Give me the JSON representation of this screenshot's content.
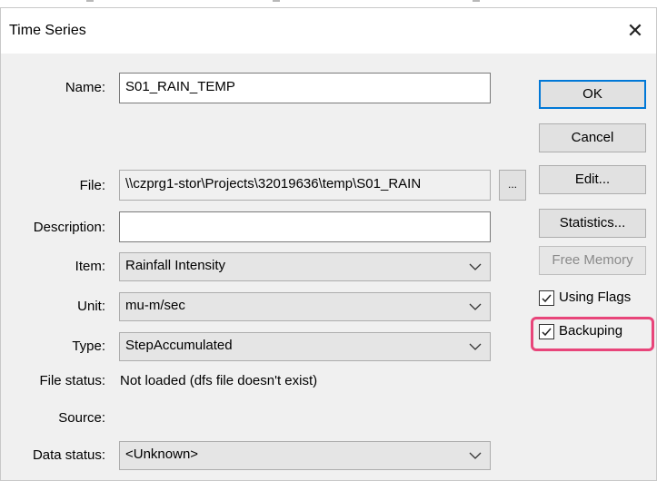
{
  "window": {
    "title": "Time Series",
    "close_glyph": "✕"
  },
  "fields": {
    "name": {
      "label": "Name:",
      "value": "S01_RAIN_TEMP"
    },
    "file": {
      "label": "File:",
      "value": "\\\\czprg1-stor\\Projects\\32019636\\temp\\S01_RAIN",
      "browse_label": "..."
    },
    "description": {
      "label": "Description:",
      "value": ""
    },
    "item": {
      "label": "Item:",
      "value": "Rainfall Intensity"
    },
    "unit": {
      "label": "Unit:",
      "value": "mu-m/sec"
    },
    "type": {
      "label": "Type:",
      "value": "StepAccumulated"
    },
    "file_status": {
      "label": "File status:",
      "value": "Not loaded (dfs file doesn't exist)"
    },
    "source": {
      "label": "Source:",
      "value": ""
    },
    "data_status": {
      "label": "Data status:",
      "value": "<Unknown>"
    }
  },
  "buttons": {
    "ok": "OK",
    "cancel": "Cancel",
    "edit": "Edit...",
    "statistics": "Statistics...",
    "free_memory": "Free Memory"
  },
  "checkboxes": {
    "using_flags": {
      "label": "Using Flags",
      "checked": true
    },
    "backuping": {
      "label": "Backuping",
      "checked": true
    }
  },
  "colors": {
    "highlight": "#e8457a",
    "default_button_border": "#0078d7"
  }
}
